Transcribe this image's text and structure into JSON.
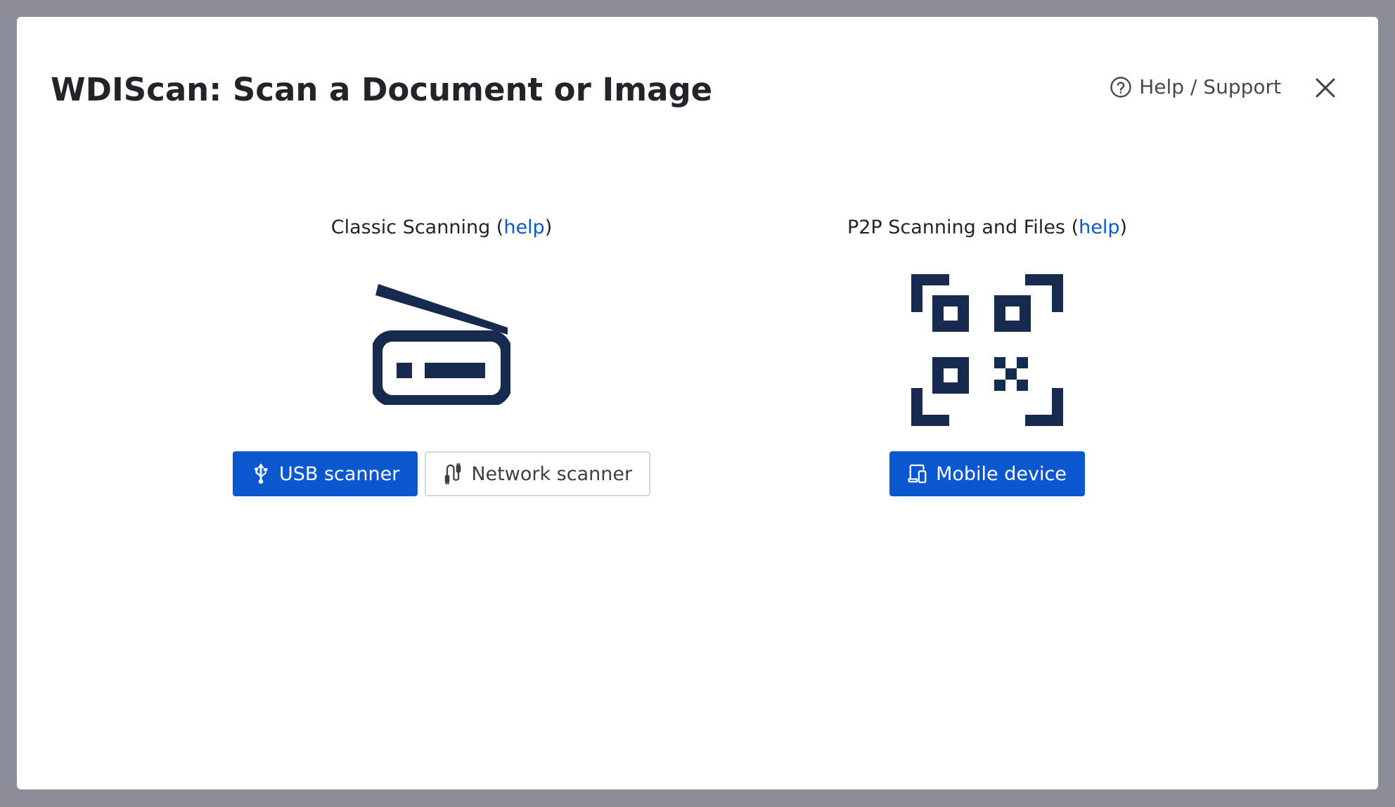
{
  "dialog": {
    "title": "WDIScan: Scan a Document or Image",
    "help_support_label": "Help / Support",
    "icons": {
      "help": "question-circle-icon",
      "close": "close-icon"
    }
  },
  "classic": {
    "heading_prefix": "Classic Scanning (",
    "help_link": "help",
    "heading_suffix": ")",
    "illustration_icon": "flatbed-scanner-icon",
    "buttons": {
      "usb_label": "USB scanner",
      "usb_icon": "usb-icon",
      "network_label": "Network scanner",
      "network_icon": "network-cable-icon"
    }
  },
  "p2p": {
    "heading_prefix": "P2P Scanning and Files (",
    "help_link": "help",
    "heading_suffix": ")",
    "illustration_icon": "qr-code-icon",
    "buttons": {
      "mobile_label": "Mobile device",
      "mobile_icon": "mobile-devices-icon"
    }
  },
  "colors": {
    "primary": "#0b57d0",
    "illustration": "#152a4e",
    "backdrop": "#8b8e97"
  }
}
